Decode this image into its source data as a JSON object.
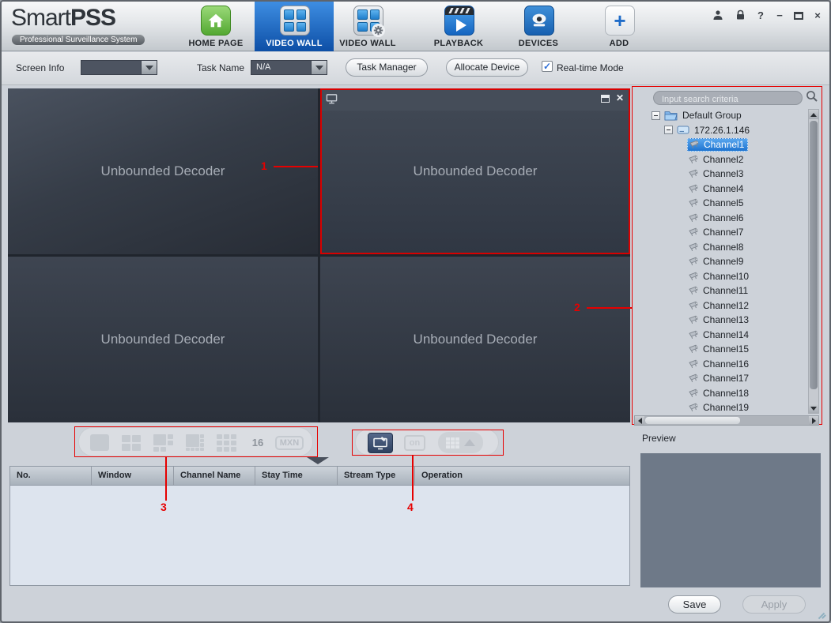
{
  "logo": {
    "name_regular": "Smart",
    "name_bold": "PSS",
    "tagline": "Professional Surveillance System"
  },
  "nav": {
    "items": [
      {
        "label": "HOME PAGE"
      },
      {
        "label": "VIDEO WALL",
        "active": true
      },
      {
        "label": "VIDEO WALL"
      },
      {
        "label": "PLAYBACK"
      },
      {
        "label": "DEVICES"
      },
      {
        "label": "ADD"
      }
    ]
  },
  "window_controls": {
    "help_glyph": "?",
    "minimize_glyph": "−",
    "close_glyph": "×"
  },
  "toolbar": {
    "screen_info_label": "Screen Info",
    "screen_info_value": "",
    "task_name_label": "Task Name",
    "task_name_value": "N/A",
    "task_manager_button": "Task Manager",
    "allocate_device_button": "Allocate Device",
    "realtime_label": "Real-time Mode",
    "realtime_check_glyph": "✓"
  },
  "video_wall": {
    "panels": [
      {
        "label": "Unbounded Decoder"
      },
      {
        "label": "Unbounded Decoder",
        "selected": true
      },
      {
        "label": "Unbounded Decoder"
      },
      {
        "label": "Unbounded Decoder"
      }
    ],
    "selected_panel_close_glyph": "✕"
  },
  "sidebar": {
    "search_placeholder": "Input search criteria",
    "tree": {
      "group_label": "Default Group",
      "device_label": "172.26.1.146",
      "channels": [
        {
          "label": "Channel1",
          "cls": "sel-row"
        },
        {
          "label": "Channel2"
        },
        {
          "label": "Channel3"
        },
        {
          "label": "Channel4"
        },
        {
          "label": "Channel5"
        },
        {
          "label": "Channel6"
        },
        {
          "label": "Channel7"
        },
        {
          "label": "Channel8"
        },
        {
          "label": "Channel9"
        },
        {
          "label": "Channel10"
        },
        {
          "label": "Channel11"
        },
        {
          "label": "Channel12"
        },
        {
          "label": "Channel13"
        },
        {
          "label": "Channel14"
        },
        {
          "label": "Channel15"
        },
        {
          "label": "Channel16"
        },
        {
          "label": "Channel17"
        },
        {
          "label": "Channel18"
        },
        {
          "label": "Channel19"
        }
      ]
    }
  },
  "layout_toolbar": {
    "sixteen_label": "16",
    "mxn_label": "MXN",
    "on_label": "on"
  },
  "table": {
    "columns": [
      "No.",
      "Window",
      "Channel Name",
      "Stay Time",
      "Stream Type",
      "Operation"
    ],
    "rows": []
  },
  "preview": {
    "label": "Preview"
  },
  "actions": {
    "save_label": "Save",
    "apply_label": "Apply"
  },
  "annotations": {
    "one": "1",
    "two": "2",
    "three": "3",
    "four": "4"
  },
  "colors": {
    "accent_blue": "#1565c0",
    "annotation_red": "#e60000",
    "panel_dark": "#363d48",
    "selection_blue": "#1f74d0",
    "home_green": "#53a832"
  }
}
